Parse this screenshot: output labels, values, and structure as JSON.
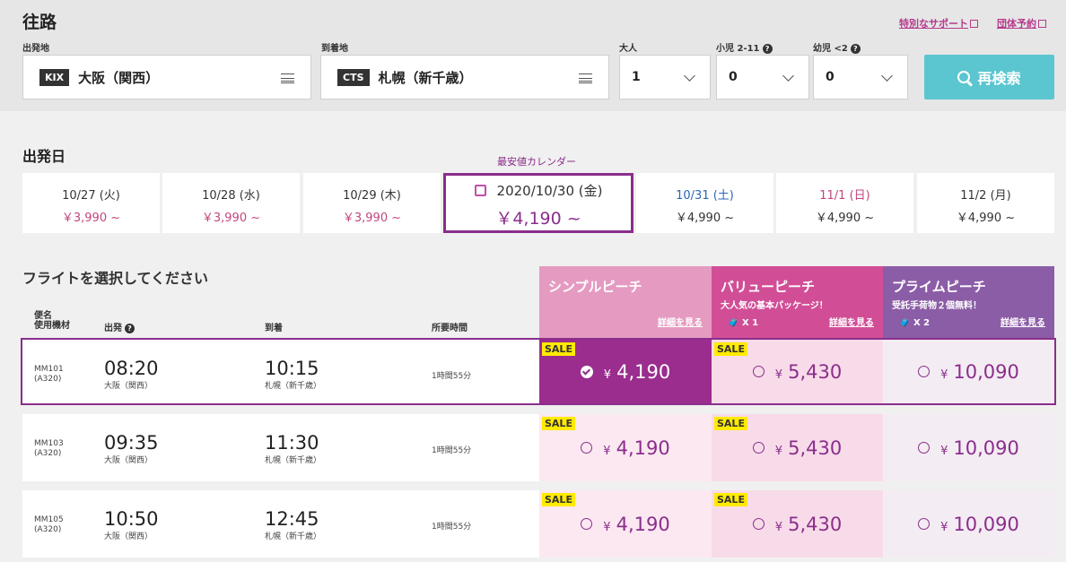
{
  "header": {
    "title": "往路",
    "links": [
      "特別なサポート",
      "団体予約"
    ]
  },
  "search": {
    "origin_label": "出発地",
    "origin_code": "KIX",
    "origin_city": "大阪（関西）",
    "dest_label": "到着地",
    "dest_code": "CTS",
    "dest_city": "札幌（新千歳）",
    "adult_label": "大人",
    "adult_value": "1",
    "child_label": "小児 2-11",
    "child_value": "0",
    "infant_label": "幼児 <2",
    "infant_value": "0",
    "button_label": "再検索"
  },
  "dates": {
    "section_title": "出発日",
    "calendar_label": "最安値カレンダー",
    "days": [
      {
        "date": "10/27 (火)",
        "price": "￥3,990 ~"
      },
      {
        "date": "10/28 (水)",
        "price": "￥3,990 ~"
      },
      {
        "date": "10/29 (木)",
        "price": "￥3,990 ~"
      },
      {
        "date": "2020/10/30 (金)",
        "price": "￥4,190 ~"
      },
      {
        "date": "10/31 (土)",
        "price": "￥4,990 ~"
      },
      {
        "date": "11/1 (日)",
        "price": "￥4,990 ~"
      },
      {
        "date": "11/2 (月)",
        "price": "￥4,990 ~"
      }
    ]
  },
  "flights": {
    "section_title": "フライトを選択してください",
    "col_flight": "便名\n使用機材",
    "col_depart": "出発",
    "col_arrive": "到着",
    "col_duration": "所要時間",
    "fares": [
      {
        "name": "シンプルピーチ",
        "desc": "",
        "bag": "",
        "link": "詳細を見る",
        "color": "#e59bc1"
      },
      {
        "name": "バリューピーチ",
        "desc": "大人気の基本パッケージ！",
        "bag": "X 1",
        "link": "詳細を見る",
        "color": "#d14e97"
      },
      {
        "name": "プライムピーチ",
        "desc": "受託手荷物２個無料！",
        "bag": "X 2",
        "link": "詳細を見る",
        "color": "#8c5da7"
      }
    ],
    "sale_label": "SALE",
    "yen": "¥",
    "rows": [
      {
        "no": "MM101",
        "eq": "(A320)",
        "dep": "08:20",
        "dep_ap": "大阪（関西）",
        "arr": "10:15",
        "arr_ap": "札幌（新千歳）",
        "dur": "1時間55分",
        "p1": "4,190",
        "p2": "5,430",
        "p3": "10,090"
      },
      {
        "no": "MM103",
        "eq": "(A320)",
        "dep": "09:35",
        "dep_ap": "大阪（関西）",
        "arr": "11:30",
        "arr_ap": "札幌（新千歳）",
        "dur": "1時間55分",
        "p1": "4,190",
        "p2": "5,430",
        "p3": "10,090"
      },
      {
        "no": "MM105",
        "eq": "(A320)",
        "dep": "10:50",
        "dep_ap": "大阪（関西）",
        "arr": "12:45",
        "arr_ap": "札幌（新千歳）",
        "dur": "1時間55分",
        "p1": "4,190",
        "p2": "5,430",
        "p3": "10,090"
      }
    ]
  }
}
